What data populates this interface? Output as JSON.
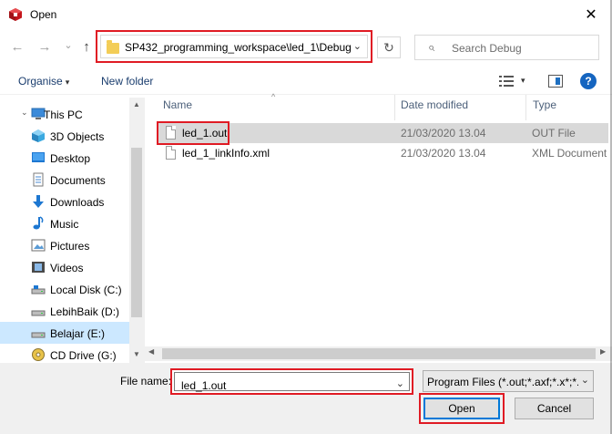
{
  "window": {
    "title": "Open",
    "close_glyph": "✕"
  },
  "nav": {
    "back_glyph": "←",
    "forward_glyph": "→",
    "recent_glyph": "⌄",
    "up_glyph": "↑",
    "address": "SP432_programming_workspace\\led_1\\Debug",
    "address_drop": "⌄",
    "refresh_glyph": "↻",
    "search_placeholder": "Search Debug",
    "search_glyph": "⌕"
  },
  "toolbar": {
    "organise_label": "Organise",
    "organise_caret": "▾",
    "new_folder_label": "New folder",
    "view_caret": "▾",
    "help_label": "?"
  },
  "sidebar": {
    "items": [
      {
        "label": "This PC",
        "icon": "pc-icon",
        "expander": "⌄"
      },
      {
        "label": "3D Objects",
        "icon": "cube-icon"
      },
      {
        "label": "Desktop",
        "icon": "desktop-icon"
      },
      {
        "label": "Documents",
        "icon": "documents-icon"
      },
      {
        "label": "Downloads",
        "icon": "downloads-icon"
      },
      {
        "label": "Music",
        "icon": "music-icon"
      },
      {
        "label": "Pictures",
        "icon": "pictures-icon"
      },
      {
        "label": "Videos",
        "icon": "videos-icon"
      },
      {
        "label": "Local Disk (C:)",
        "icon": "drive-icon"
      },
      {
        "label": "LebihBaik (D:)",
        "icon": "drive-icon"
      },
      {
        "label": "Belajar (E:)",
        "icon": "drive-icon",
        "selected": true
      },
      {
        "label": "CD Drive (G:)",
        "icon": "cd-drive-icon"
      }
    ]
  },
  "filelist": {
    "columns": [
      "Name",
      "Date modified",
      "Type"
    ],
    "sort_glyph": "^",
    "rows": [
      {
        "name": "led_1.out",
        "date": "21/03/2020 13.04",
        "type": "OUT File",
        "selected": true
      },
      {
        "name": "led_1_linkInfo.xml",
        "date": "21/03/2020 13.04",
        "type": "XML Document"
      }
    ]
  },
  "scroll": {
    "up": "▲",
    "down": "▼",
    "left": "◀",
    "right": "▶"
  },
  "footer": {
    "file_name_label": "File name:",
    "file_name_value": "led_1.out",
    "file_name_drop": "⌄",
    "file_type_value": "Program Files (*.out;*.axf;*.x*;*.",
    "file_type_drop": "⌄",
    "open_label": "Open",
    "cancel_label": "Cancel"
  },
  "colors": {
    "highlight": "#e01b24",
    "accent": "#0078d7",
    "selected_nav": "#cce8ff"
  }
}
